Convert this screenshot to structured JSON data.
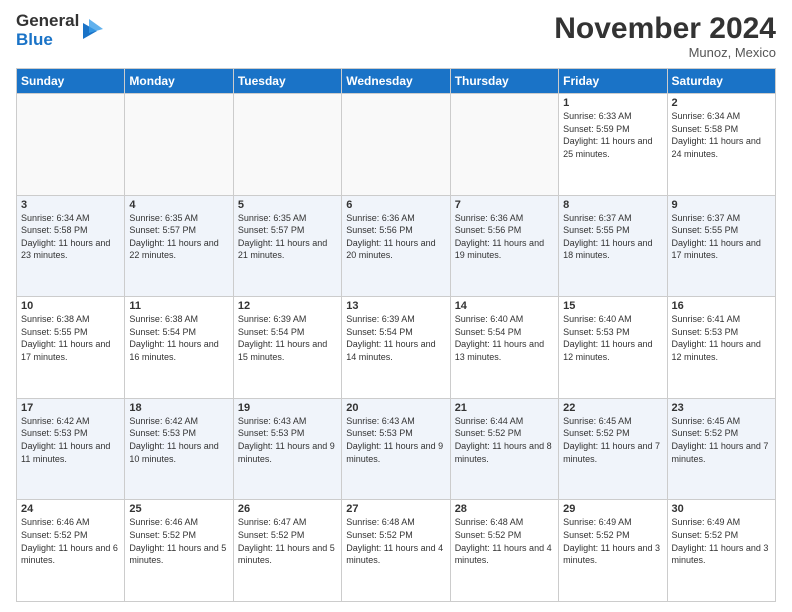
{
  "logo": {
    "line1": "General",
    "line2": "Blue"
  },
  "title": "November 2024",
  "location": "Munoz, Mexico",
  "days_of_week": [
    "Sunday",
    "Monday",
    "Tuesday",
    "Wednesday",
    "Thursday",
    "Friday",
    "Saturday"
  ],
  "weeks": [
    [
      {
        "day": "",
        "info": ""
      },
      {
        "day": "",
        "info": ""
      },
      {
        "day": "",
        "info": ""
      },
      {
        "day": "",
        "info": ""
      },
      {
        "day": "",
        "info": ""
      },
      {
        "day": "1",
        "info": "Sunrise: 6:33 AM\nSunset: 5:59 PM\nDaylight: 11 hours and 25 minutes."
      },
      {
        "day": "2",
        "info": "Sunrise: 6:34 AM\nSunset: 5:58 PM\nDaylight: 11 hours and 24 minutes."
      }
    ],
    [
      {
        "day": "3",
        "info": "Sunrise: 6:34 AM\nSunset: 5:58 PM\nDaylight: 11 hours and 23 minutes."
      },
      {
        "day": "4",
        "info": "Sunrise: 6:35 AM\nSunset: 5:57 PM\nDaylight: 11 hours and 22 minutes."
      },
      {
        "day": "5",
        "info": "Sunrise: 6:35 AM\nSunset: 5:57 PM\nDaylight: 11 hours and 21 minutes."
      },
      {
        "day": "6",
        "info": "Sunrise: 6:36 AM\nSunset: 5:56 PM\nDaylight: 11 hours and 20 minutes."
      },
      {
        "day": "7",
        "info": "Sunrise: 6:36 AM\nSunset: 5:56 PM\nDaylight: 11 hours and 19 minutes."
      },
      {
        "day": "8",
        "info": "Sunrise: 6:37 AM\nSunset: 5:55 PM\nDaylight: 11 hours and 18 minutes."
      },
      {
        "day": "9",
        "info": "Sunrise: 6:37 AM\nSunset: 5:55 PM\nDaylight: 11 hours and 17 minutes."
      }
    ],
    [
      {
        "day": "10",
        "info": "Sunrise: 6:38 AM\nSunset: 5:55 PM\nDaylight: 11 hours and 17 minutes."
      },
      {
        "day": "11",
        "info": "Sunrise: 6:38 AM\nSunset: 5:54 PM\nDaylight: 11 hours and 16 minutes."
      },
      {
        "day": "12",
        "info": "Sunrise: 6:39 AM\nSunset: 5:54 PM\nDaylight: 11 hours and 15 minutes."
      },
      {
        "day": "13",
        "info": "Sunrise: 6:39 AM\nSunset: 5:54 PM\nDaylight: 11 hours and 14 minutes."
      },
      {
        "day": "14",
        "info": "Sunrise: 6:40 AM\nSunset: 5:54 PM\nDaylight: 11 hours and 13 minutes."
      },
      {
        "day": "15",
        "info": "Sunrise: 6:40 AM\nSunset: 5:53 PM\nDaylight: 11 hours and 12 minutes."
      },
      {
        "day": "16",
        "info": "Sunrise: 6:41 AM\nSunset: 5:53 PM\nDaylight: 11 hours and 12 minutes."
      }
    ],
    [
      {
        "day": "17",
        "info": "Sunrise: 6:42 AM\nSunset: 5:53 PM\nDaylight: 11 hours and 11 minutes."
      },
      {
        "day": "18",
        "info": "Sunrise: 6:42 AM\nSunset: 5:53 PM\nDaylight: 11 hours and 10 minutes."
      },
      {
        "day": "19",
        "info": "Sunrise: 6:43 AM\nSunset: 5:53 PM\nDaylight: 11 hours and 9 minutes."
      },
      {
        "day": "20",
        "info": "Sunrise: 6:43 AM\nSunset: 5:53 PM\nDaylight: 11 hours and 9 minutes."
      },
      {
        "day": "21",
        "info": "Sunrise: 6:44 AM\nSunset: 5:52 PM\nDaylight: 11 hours and 8 minutes."
      },
      {
        "day": "22",
        "info": "Sunrise: 6:45 AM\nSunset: 5:52 PM\nDaylight: 11 hours and 7 minutes."
      },
      {
        "day": "23",
        "info": "Sunrise: 6:45 AM\nSunset: 5:52 PM\nDaylight: 11 hours and 7 minutes."
      }
    ],
    [
      {
        "day": "24",
        "info": "Sunrise: 6:46 AM\nSunset: 5:52 PM\nDaylight: 11 hours and 6 minutes."
      },
      {
        "day": "25",
        "info": "Sunrise: 6:46 AM\nSunset: 5:52 PM\nDaylight: 11 hours and 5 minutes."
      },
      {
        "day": "26",
        "info": "Sunrise: 6:47 AM\nSunset: 5:52 PM\nDaylight: 11 hours and 5 minutes."
      },
      {
        "day": "27",
        "info": "Sunrise: 6:48 AM\nSunset: 5:52 PM\nDaylight: 11 hours and 4 minutes."
      },
      {
        "day": "28",
        "info": "Sunrise: 6:48 AM\nSunset: 5:52 PM\nDaylight: 11 hours and 4 minutes."
      },
      {
        "day": "29",
        "info": "Sunrise: 6:49 AM\nSunset: 5:52 PM\nDaylight: 11 hours and 3 minutes."
      },
      {
        "day": "30",
        "info": "Sunrise: 6:49 AM\nSunset: 5:52 PM\nDaylight: 11 hours and 3 minutes."
      }
    ]
  ]
}
